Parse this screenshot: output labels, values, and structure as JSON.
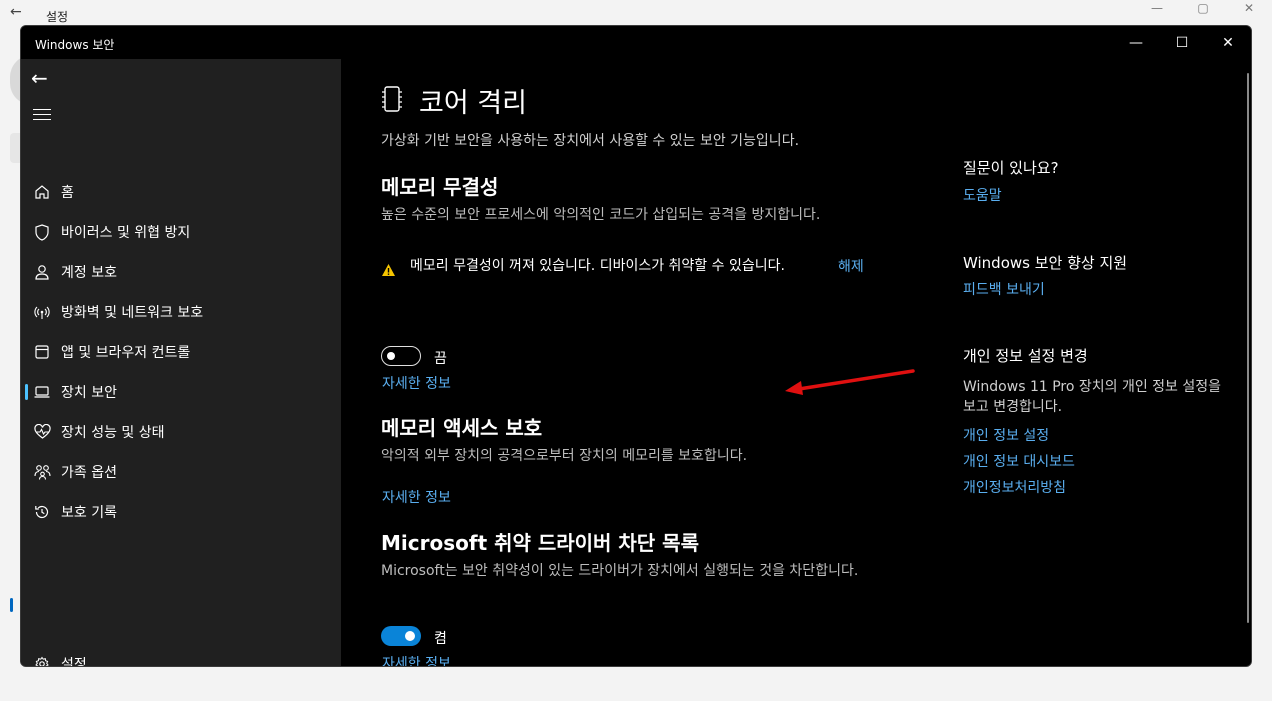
{
  "background_window": {
    "title": "설정",
    "back_glyph": "←",
    "ctrl_min": "—",
    "ctrl_max": "▢",
    "ctrl_close": "✕"
  },
  "window": {
    "title": "Windows 보안",
    "ctrl_min": "—",
    "ctrl_max": "☐",
    "ctrl_close": "✕"
  },
  "sidebar": {
    "back_glyph": "←",
    "items": [
      {
        "label": "홈",
        "icon": "home-icon"
      },
      {
        "label": "바이러스 및 위협 방지",
        "icon": "shield-icon"
      },
      {
        "label": "계정 보호",
        "icon": "person-icon"
      },
      {
        "label": "방화벽 및 네트워크 보호",
        "icon": "wireless-icon"
      },
      {
        "label": "앱 및 브라우저 컨트롤",
        "icon": "app-window-icon"
      },
      {
        "label": "장치 보안",
        "icon": "laptop-icon",
        "active": true
      },
      {
        "label": "장치 성능 및 상태",
        "icon": "heart-pulse-icon"
      },
      {
        "label": "가족 옵션",
        "icon": "family-icon"
      },
      {
        "label": "보호 기록",
        "icon": "history-icon"
      }
    ],
    "settings_label": "설정",
    "settings_icon": "gear-icon"
  },
  "main": {
    "title": "코어 격리",
    "subtitle": "가상화 기반 보안을 사용하는 장치에서 사용할 수 있는 보안 기능입니다.",
    "memory_integrity": {
      "heading": "메모리 무결성",
      "description": "높은 수준의 보안 프로세스에 악의적인 코드가 삽입되는 공격을 방지합니다.",
      "warning_text": "메모리 무결성이 꺼져 있습니다. 디바이스가 취약할 수 있습니다.",
      "warning_link": "해제",
      "toggle_state": "off",
      "toggle_label": "끔",
      "more_info": "자세한 정보"
    },
    "memory_access": {
      "heading": "메모리 액세스 보호",
      "description": "악의적  외부 장치의 공격으로부터 장치의 메모리를 보호합니다.",
      "more_info": "자세한 정보"
    },
    "driver_blocklist": {
      "heading": "Microsoft 취약 드라이버 차단 목록",
      "description": "Microsoft는 보안 취약성이 있는 드라이버가 장치에서 실행되는 것을 차단합니다.",
      "toggle_state": "on",
      "toggle_label": "켬",
      "more_info": "자세한 정보"
    }
  },
  "right_panel": {
    "question_heading": "질문이 있나요?",
    "help_link": "도움말",
    "improve_heading": "Windows 보안 향상 지원",
    "feedback_link": "피드백 보내기",
    "privacy_heading": "개인 정보 설정 변경",
    "privacy_text": "Windows 11 Pro 장치의 개인 정보 설정을 보고 변경합니다.",
    "privacy_settings_link": "개인 정보 설정",
    "privacy_dashboard_link": "개인 정보 대시보드",
    "privacy_statement_link": "개인정보처리방침"
  },
  "colors": {
    "accent_link": "#5aaeef",
    "toggle_on": "#0a84d8",
    "warning": "#f5c400",
    "annotation_arrow": "#e01010"
  }
}
